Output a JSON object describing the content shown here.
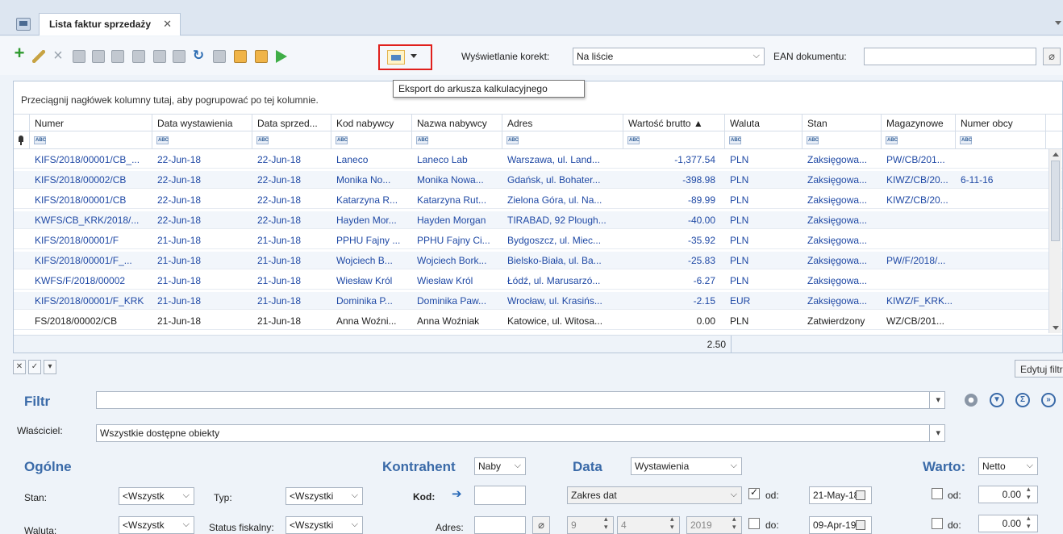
{
  "tab": {
    "title": "Lista faktur sprzedaży",
    "close": "✕"
  },
  "toolbar": {
    "corrections_label": "Wyświetlanie korekt:",
    "corrections_value": "Na liście",
    "ean_label": "EAN dokumentu:",
    "ean_value": "",
    "export_tooltip": "Eksport do arkusza kalkulacyjnego"
  },
  "grid": {
    "group_hint": "Przeciągnij nagłówek kolumny tutaj, aby pogrupować po tej kolumnie.",
    "columns": [
      "Numer",
      "Data wystawienia",
      "Data sprzed...",
      "Kod nabywcy",
      "Nazwa nabywcy",
      "Adres",
      "Wartość brutto ▲",
      "Waluta",
      "Stan",
      "Magazynowe",
      "Numer obcy"
    ],
    "rows": [
      [
        "KIFS/2018/00001/CB_...",
        "22-Jun-18",
        "22-Jun-18",
        "Laneco",
        "Laneco Lab",
        "Warszawa, ul. Land...",
        "-1,377.54",
        "PLN",
        "Zaksięgowa...",
        "PW/CB/201...",
        ""
      ],
      [
        "KIFS/2018/00002/CB",
        "22-Jun-18",
        "22-Jun-18",
        "Monika No...",
        "Monika Nowa...",
        "Gdańsk, ul. Bohater...",
        "-398.98",
        "PLN",
        "Zaksięgowa...",
        "KIWZ/CB/20...",
        "6-11-16"
      ],
      [
        "KIFS/2018/00001/CB",
        "22-Jun-18",
        "22-Jun-18",
        "Katarzyna R...",
        "Katarzyna Rut...",
        "Zielona Góra, ul. Na...",
        "-89.99",
        "PLN",
        "Zaksięgowa...",
        "KIWZ/CB/20...",
        ""
      ],
      [
        "KWFS/CB_KRK/2018/...",
        "22-Jun-18",
        "22-Jun-18",
        "Hayden Mor...",
        "Hayden Morgan",
        "TIRABAD, 92 Plough...",
        "-40.00",
        "PLN",
        "Zaksięgowa...",
        "",
        ""
      ],
      [
        "KIFS/2018/00001/F",
        "21-Jun-18",
        "21-Jun-18",
        "PPHU Fajny ...",
        "PPHU Fajny Ci...",
        "Bydgoszcz, ul. Miec...",
        "-35.92",
        "PLN",
        "Zaksięgowa...",
        "",
        ""
      ],
      [
        "KIFS/2018/00001/F_...",
        "21-Jun-18",
        "21-Jun-18",
        "Wojciech B...",
        "Wojciech Bork...",
        "Bielsko-Biała, ul. Ba...",
        "-25.83",
        "PLN",
        "Zaksięgowa...",
        "PW/F/2018/...",
        ""
      ],
      [
        "KWFS/F/2018/00002",
        "21-Jun-18",
        "21-Jun-18",
        "Wiesław Król",
        "Wiesław Król",
        "Łódź, ul. Marusarzó...",
        "-6.27",
        "PLN",
        "Zaksięgowa...",
        "",
        ""
      ],
      [
        "KIFS/2018/00001/F_KRK",
        "21-Jun-18",
        "21-Jun-18",
        "Dominika P...",
        "Dominika Paw...",
        "Wrocław, ul. Krasińs...",
        "-2.15",
        "EUR",
        "Zaksięgowa...",
        "KIWZ/F_KRK...",
        ""
      ],
      [
        "FS/2018/00002/CB",
        "21-Jun-18",
        "21-Jun-18",
        "Anna Woźni...",
        "Anna Woźniak",
        "Katowice, ul. Witosa...",
        "0.00",
        "PLN",
        "Zatwierdzony",
        "WZ/CB/201...",
        ""
      ]
    ],
    "summary_value": "2.50"
  },
  "filterbar": {
    "edit_filter": "Edytuj filtr"
  },
  "filter": {
    "title": "Filtr",
    "owner_label": "Właściciel:",
    "owner_value": "Wszystkie dostępne obiekty",
    "general_title": "Ogólne",
    "stan_label": "Stan:",
    "stan_value": "<Wszystk",
    "typ_label": "Typ:",
    "typ_value": "<Wszystki",
    "waluta_label": "Waluta:",
    "waluta_value": "<Wszystk",
    "status_label": "Status fiskalny:",
    "status_value": "<Wszystki",
    "contractor_title": "Kontrahent",
    "contractor_value": "Naby",
    "kod_label": "Kod:",
    "adres_label": "Adres:",
    "data_title": "Data",
    "data_value": "Wystawienia",
    "zakres_value": "Zakres dat",
    "od_label": "od:",
    "do_label": "do:",
    "date_from": "21-May-18",
    "date_to": "09-Apr-19",
    "spin_a": "9",
    "spin_b": "4",
    "spin_c": "2019",
    "wartos_title": "Warto:",
    "netto_value": "Netto",
    "od2_label": "od:",
    "do2_label": "do:",
    "amount_from": "0.00",
    "amount_to": "0.00"
  }
}
